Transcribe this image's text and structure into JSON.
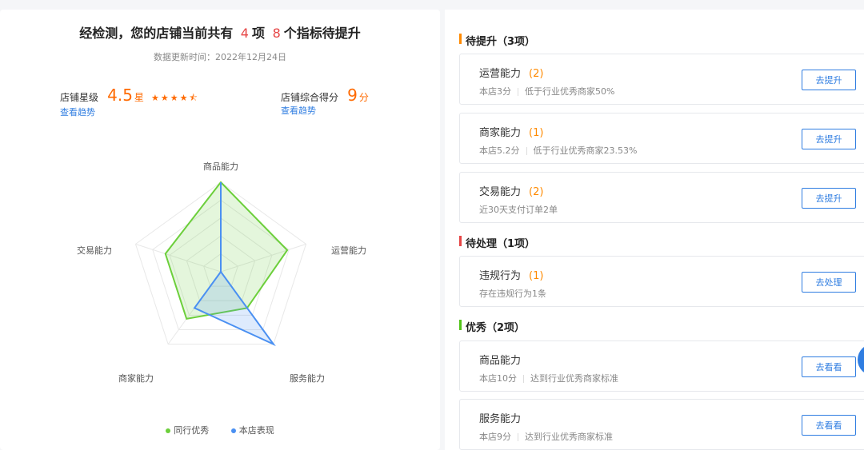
{
  "summary": {
    "prefix": "经检测，您的店铺当前共有",
    "count_a": "4",
    "mid": "项",
    "count_b": "8",
    "suffix": "个指标待提升",
    "updated": "数据更新时间：2022年12月24日"
  },
  "rating": {
    "label": "店铺星级",
    "value": "4.5",
    "unit": "星",
    "stars_value": 4.5,
    "trend": "查看趋势"
  },
  "score": {
    "label": "店铺综合得分",
    "value": "9",
    "unit": "分",
    "trend": "查看趋势"
  },
  "radar": {
    "axes": [
      "商品能力",
      "运营能力",
      "服务能力",
      "商家能力",
      "交易能力"
    ],
    "series": [
      {
        "name": "同行优秀",
        "color": "#6ccf3b",
        "values": [
          1.0,
          0.78,
          0.5,
          0.65,
          0.65
        ]
      },
      {
        "name": "本店表现",
        "color": "#4a90f2",
        "values": [
          1.0,
          0.0,
          1.0,
          0.5,
          0.0
        ]
      }
    ]
  },
  "sections": [
    {
      "title": "待提升（3项）",
      "color": "#ff8a00",
      "items": [
        {
          "name": "运营能力",
          "count": "(2)",
          "detail_a": "本店3分",
          "detail_b": "低于行业优秀商家50%",
          "action": "去提升"
        },
        {
          "name": "商家能力",
          "count": "(1)",
          "detail_a": "本店5.2分",
          "detail_b": "低于行业优秀商家23.53%",
          "action": "去提升"
        },
        {
          "name": "交易能力",
          "count": "(2)",
          "detail_a": "近30天支付订单2单",
          "detail_b": "",
          "action": "去提升"
        }
      ]
    },
    {
      "title": "待处理（1项）",
      "color": "#e64545",
      "items": [
        {
          "name": "违规行为",
          "count": "(1)",
          "detail_a": "存在违规行为1条",
          "detail_b": "",
          "action": "去处理"
        }
      ]
    },
    {
      "title": "优秀（2项）",
      "color": "#52c41a",
      "items": [
        {
          "name": "商品能力",
          "count": "",
          "detail_a": "本店10分",
          "detail_b": "达到行业优秀商家标准",
          "action": "去看看"
        },
        {
          "name": "服务能力",
          "count": "",
          "detail_a": "本店9分",
          "detail_b": "达到行业优秀商家标准",
          "action": "去看看"
        }
      ]
    }
  ]
}
